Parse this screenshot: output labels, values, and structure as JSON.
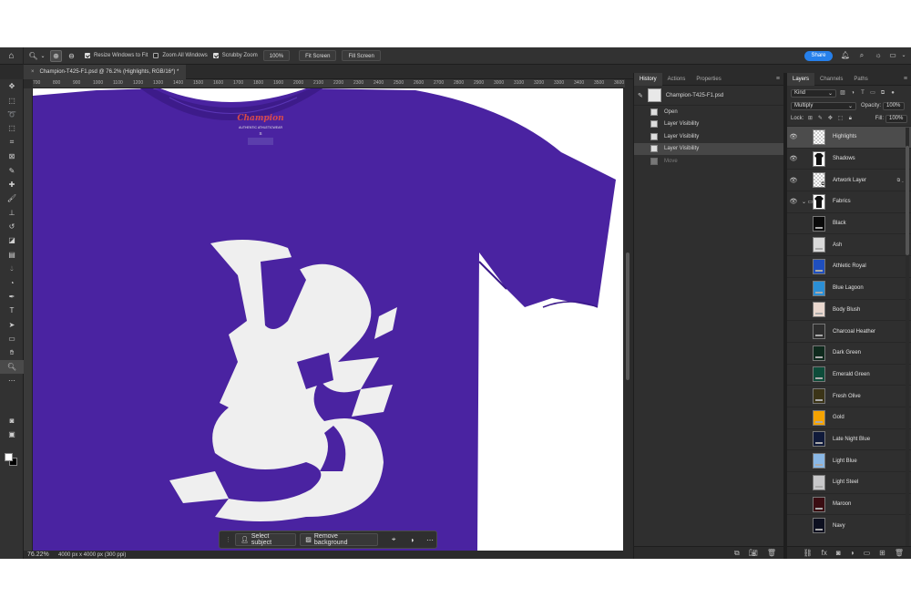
{
  "options_bar": {
    "resize_windows": "Resize Windows to Fit",
    "zoom_all": "Zoom All Windows",
    "scrubby_zoom": "Scrubby Zoom",
    "zoom_value": "100%",
    "fit_screen": "Fit Screen",
    "fill_screen": "Fill Screen",
    "share": "Share"
  },
  "document": {
    "tab_title": "Champion-T425-F1.psd @ 76.2% (Highlights, RGB/16*) *",
    "zoom": "76.22%",
    "info": "4000 px x 4000 px (300 ppi)"
  },
  "ruler_ticks": [
    "700",
    "800",
    "900",
    "1000",
    "1100",
    "1200",
    "1300",
    "1400",
    "1500",
    "1600",
    "1700",
    "1800",
    "1900",
    "2000",
    "2100",
    "2200",
    "2300",
    "2400",
    "2500",
    "2600",
    "2700",
    "2800",
    "2900",
    "3000",
    "3100",
    "3200",
    "3300",
    "3400",
    "3500",
    "3600"
  ],
  "artwork": {
    "brand": "Champion",
    "tag_line": "AUTHENTIC ATHLETICWEAR",
    "size": "S",
    "shirt_color": "#4a23a1",
    "logo_color": "#efefef"
  },
  "context_bar": {
    "select_subject": "Select subject",
    "remove_background": "Remove background"
  },
  "history_panel": {
    "tabs": [
      "History",
      "Actions",
      "Properties"
    ],
    "snapshot": "Champion-T425-F1.psd",
    "items": [
      {
        "label": "Open",
        "state": "normal"
      },
      {
        "label": "Layer Visibility",
        "state": "normal"
      },
      {
        "label": "Layer Visibility",
        "state": "normal"
      },
      {
        "label": "Layer Visibility",
        "state": "selected"
      },
      {
        "label": "Move",
        "state": "dim"
      }
    ]
  },
  "layers_panel": {
    "tabs": [
      "Layers",
      "Channels",
      "Paths"
    ],
    "kind": "Kind",
    "blend_mode": "Multiply",
    "opacity_label": "Opacity:",
    "opacity_value": "100%",
    "lock_label": "Lock:",
    "fill_label": "Fill:",
    "fill_value": "100%",
    "layers": [
      {
        "name": "Highlights",
        "thumb": "checker",
        "visible": true,
        "selected": true
      },
      {
        "name": "Shadows",
        "thumb": "shirt",
        "visible": true,
        "selected": false
      },
      {
        "name": "Artwork Layer",
        "thumb": "smart",
        "visible": true,
        "selected": false
      },
      {
        "name": "Fabrics",
        "thumb": "group",
        "visible": true,
        "selected": false
      },
      {
        "name": "Black",
        "color": "#0a0a0a",
        "visible": false
      },
      {
        "name": "Ash",
        "color": "#d9d9d9",
        "visible": false
      },
      {
        "name": "Athletic Royal",
        "color": "#1f4fbf",
        "visible": false
      },
      {
        "name": "Blue Lagoon",
        "color": "#2b8fd6",
        "visible": false
      },
      {
        "name": "Body Blush",
        "color": "#ead8cf",
        "visible": false
      },
      {
        "name": "Charcoal Heather",
        "color": "#2e2e2e",
        "visible": false
      },
      {
        "name": "Dark Green",
        "color": "#0f2a1d",
        "visible": false
      },
      {
        "name": "Emerald Green",
        "color": "#0e4c3a",
        "visible": false
      },
      {
        "name": "Fresh Olive",
        "color": "#3b3417",
        "visible": false
      },
      {
        "name": "Gold",
        "color": "#f5a300",
        "visible": false
      },
      {
        "name": "Late Night Blue",
        "color": "#101a3a",
        "visible": false
      },
      {
        "name": "Light Blue",
        "color": "#8ab8e6",
        "visible": false
      },
      {
        "name": "Light Steel",
        "color": "#c7c7c9",
        "visible": false
      },
      {
        "name": "Maroon",
        "color": "#3a0d12",
        "visible": false
      },
      {
        "name": "Navy",
        "color": "#0d1020",
        "visible": false
      }
    ]
  }
}
